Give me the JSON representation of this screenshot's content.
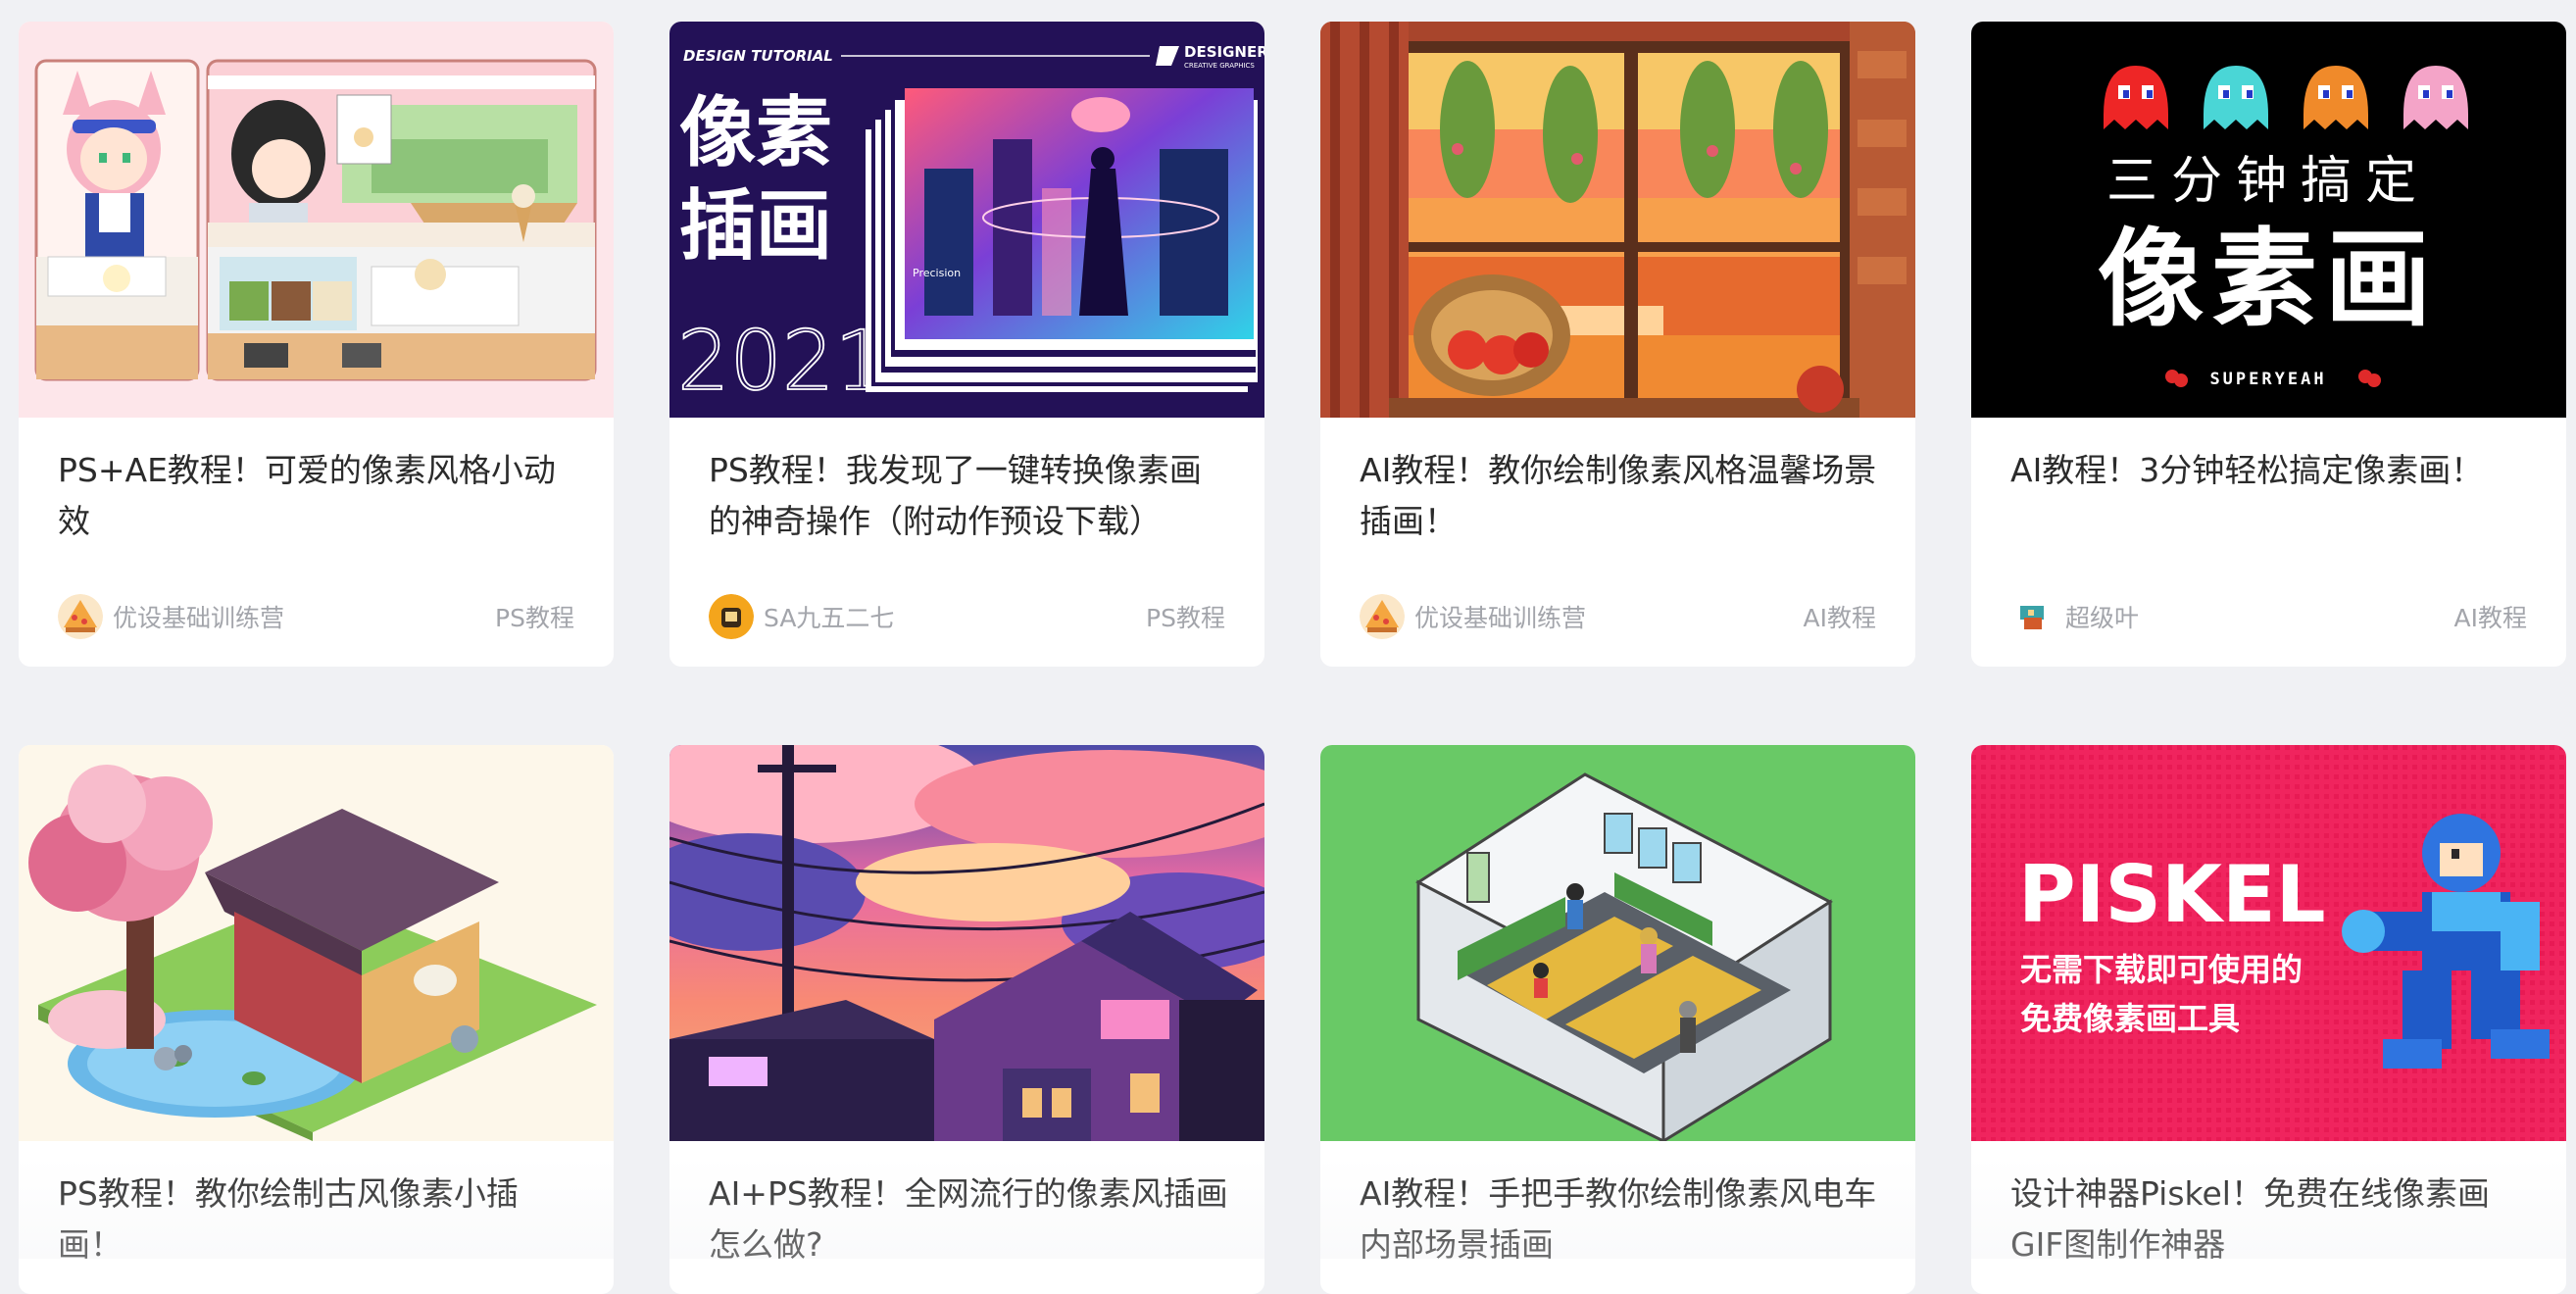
{
  "cards": [
    {
      "title": "PS+AE教程！可爱的像素风格小动效",
      "author": "优设基础训练营",
      "tag": "PS教程",
      "icon": "pixel-cafe-thumbnail"
    },
    {
      "title": "PS教程！我发现了一键转换像素画的神奇操作（附动作预设下载）",
      "author": "SA九五二七",
      "tag": "PS教程",
      "icon": "design-tutorial-thumbnail",
      "thumb_text": {
        "header": "DESIGN TUTORIAL",
        "brand": "DESIGNER",
        "brand_sub": "CREATIVE GRAPHICS",
        "big1": "像素",
        "big2": "插画",
        "year": "2021",
        "poster_word": "Precision"
      }
    },
    {
      "title": "AI教程！教你绘制像素风格温馨场景插画！",
      "author": "优设基础训练营",
      "tag": "AI教程",
      "icon": "pixel-window-thumbnail"
    },
    {
      "title": "AI教程！3分钟轻松搞定像素画！",
      "author": "超级叶",
      "tag": "AI教程",
      "icon": "pacman-ghosts-thumbnail",
      "thumb_text": {
        "line1": "三分钟搞定",
        "line2": "像素画",
        "brand": "SUPERYEAH"
      }
    },
    {
      "title": "PS教程！教你绘制古风像素小插画！",
      "icon": "pixel-house-thumbnail"
    },
    {
      "title": "AI+PS教程！全网流行的像素风插画怎么做?",
      "icon": "pixel-sunset-thumbnail"
    },
    {
      "title": "AI教程！手把手教你绘制像素风电车内部场景插画",
      "icon": "pixel-train-thumbnail"
    },
    {
      "title": "设计神器Piskel！免费在线像素画GIF图制作神器",
      "icon": "piskel-thumbnail",
      "thumb_text": {
        "word": "PISKEL",
        "line1": "无需下载即可使用的",
        "line2": "免费像素画工具"
      }
    }
  ],
  "colors": {
    "page_bg": "#f0f1f4",
    "card_bg": "#ffffff",
    "title": "#2b2b2b",
    "meta": "#a3a5ab"
  }
}
